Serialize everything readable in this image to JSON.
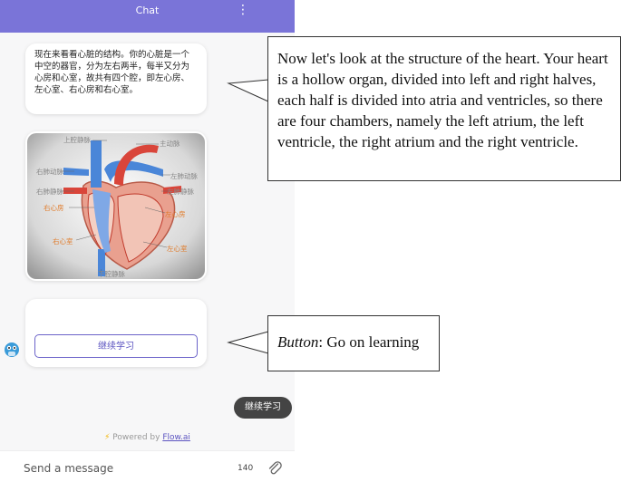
{
  "header": {
    "title": "Chat",
    "menu_icon": "kebab-menu-icon"
  },
  "messages": {
    "intro_text": "现在来看看心脏的结构。你的心脏是一个中空的器官，分为左右两半，每半又分为心房和心室，故共有四个腔，即左心房、左心室、右心房和右心室。",
    "diagram": {
      "labels": {
        "svc": "上腔静脉",
        "aorta": "主动脉",
        "rpa": "右肺动脉",
        "lpa": "左肺动脉",
        "rpv": "右肺静脉",
        "lpv": "左肺静脉",
        "ra": "右心房",
        "la": "左心房",
        "rv": "右心室",
        "lv": "左心室",
        "ivc": "下腔静脉"
      }
    },
    "button_label": "继续学习"
  },
  "quick_reply": "继续学习",
  "powered": {
    "prefix": "Powered by",
    "brand": "Flow.ai"
  },
  "composer": {
    "placeholder": "Send a message",
    "char_count": "140"
  },
  "annotations": {
    "top": "Now let's look at the structure of the heart. Your heart is a hollow organ, divided into left and right halves, each half is divided into atria and ventricles, so there are four chambers, namely the left atrium, the left ventricle, the right atrium and the right ventricle.",
    "button_term": "Button",
    "button_desc": ": Go on learning"
  },
  "colors": {
    "header": "#7a74d8",
    "accent": "#5b53c0",
    "label_orange": "#e07b2a",
    "vessel_blue": "#4a86d8",
    "vessel_red": "#d9453a"
  }
}
